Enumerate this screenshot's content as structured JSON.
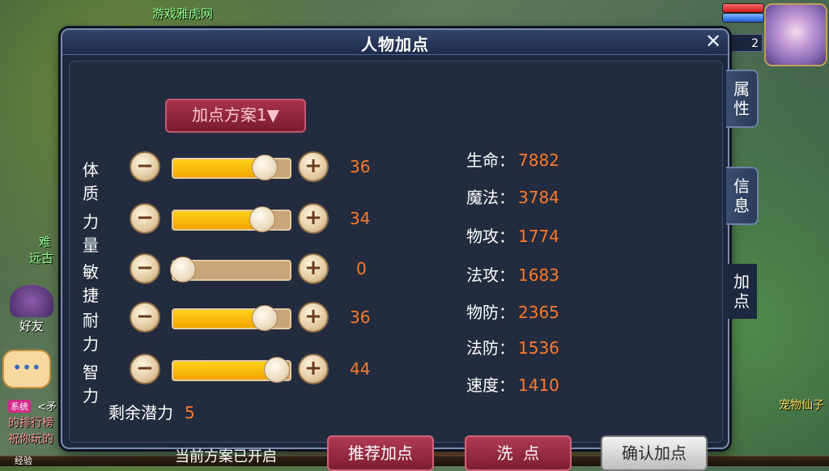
{
  "background": {
    "site_watermark": "游戏雅虎网",
    "left_name_1": "难",
    "left_name_2": "远古",
    "friend_label": "好友",
    "system_badge": "系统",
    "chat_line_1": "<矛",
    "chat_line_2": "的排行榜",
    "chat_line_3": "祝你玩的",
    "pet_label": "宠物仙子",
    "level": "2",
    "exp_label": "经验"
  },
  "dialog": {
    "title": "人物加点",
    "close_icon": "close-icon",
    "scheme_button": "加点方案1▼",
    "stats": [
      {
        "label": "体质",
        "value": "36",
        "fill_fraction": 0.78
      },
      {
        "label": "力量",
        "value": "34",
        "fill_fraction": 0.76
      },
      {
        "label": "敏捷",
        "value": "0",
        "fill_fraction": 0.0
      },
      {
        "label": "耐力",
        "value": "36",
        "fill_fraction": 0.78
      },
      {
        "label": "智力",
        "value": "44",
        "fill_fraction": 0.88
      }
    ],
    "minus_symbol": "−",
    "plus_symbol": "+",
    "remaining_label": "剩余潜力",
    "remaining_value": "5",
    "attributes": [
      {
        "label": "生命：",
        "value": "7882"
      },
      {
        "label": "魔法：",
        "value": "3784"
      },
      {
        "label": "物攻：",
        "value": "1774"
      },
      {
        "label": "法攻：",
        "value": "1683"
      },
      {
        "label": "物防：",
        "value": "2365"
      },
      {
        "label": "法防：",
        "value": "1536"
      },
      {
        "label": "速度：",
        "value": "1410"
      }
    ],
    "status_text": "当前方案已开启",
    "buttons": {
      "recommend": "推荐加点",
      "reset": "洗  点",
      "confirm": "确认加点"
    },
    "tabs": [
      {
        "label": "属性"
      },
      {
        "label": "信息"
      },
      {
        "label": "加点"
      }
    ]
  },
  "colors": {
    "accent_value": "#ff7a2a",
    "bar_fill": "#ffc20e",
    "dialog_bg": "#1c2740"
  }
}
